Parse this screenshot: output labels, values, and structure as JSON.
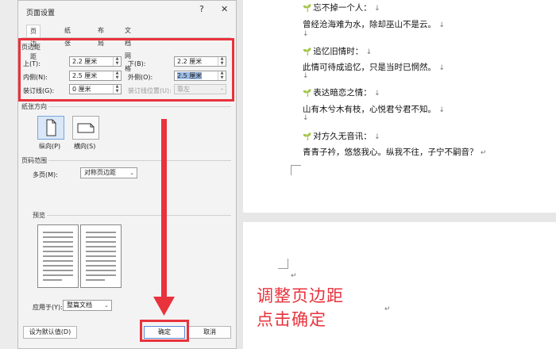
{
  "dialog": {
    "title": "页面设置",
    "help": "?",
    "close": "✕",
    "tabs": [
      "页边距",
      "纸张",
      "布局",
      "文档网格"
    ],
    "margins_section": "页边距",
    "top_label": "上(T):",
    "top_value": "2.2 厘米",
    "bottom_label": "下(B):",
    "bottom_value": "2.2 厘米",
    "inner_label": "内侧(N):",
    "inner_value": "2.5 厘米",
    "outer_label": "外侧(O):",
    "outer_value": "2.5 厘米",
    "gutter_label": "装订线(G):",
    "gutter_value": "0 厘米",
    "gutter_pos_label": "装订线位置(U):",
    "gutter_pos_value": "靠左",
    "orientation_section": "纸张方向",
    "portrait_label": "纵向(P)",
    "landscape_label": "横向(S)",
    "pages_section": "页码范围",
    "multi_label": "多页(M):",
    "multi_value": "对称页边距",
    "preview_section": "预览",
    "apply_label": "应用于(Y):",
    "apply_value": "整篇文档",
    "default_button": "设为默认值(D)",
    "ok_button": "确定",
    "cancel_button": "取消"
  },
  "document": {
    "lines": [
      "忘不掉一个人：",
      "曾经沧海难为水，除却巫山不是云。",
      "追忆旧情时：",
      "此情可待成追忆，只是当时已惘然。",
      "表达暗恋之情：",
      "山有木兮木有枝，心悦君兮君不知。",
      "对方久无音讯：",
      "青青子衿，悠悠我心。纵我不往，子宁不嗣音？"
    ],
    "para_mark": "↓",
    "end_mark": "↵"
  },
  "annotation": {
    "line1": "调整页边距",
    "line2": "点击确定"
  },
  "colors": {
    "accent": "#e8323c",
    "selection": "#9bbbe6"
  }
}
